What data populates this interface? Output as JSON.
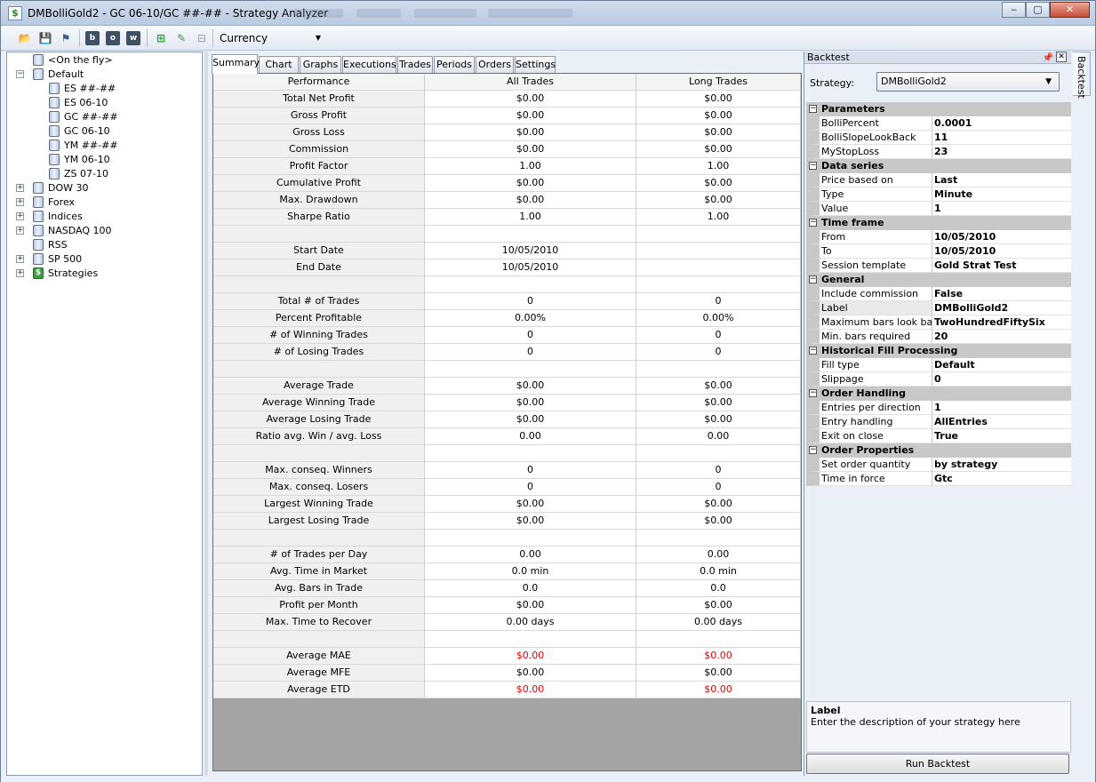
{
  "window": {
    "title": "DMBolliGold2 - GC 06-10/GC ##-## - Strategy Analyzer",
    "buttons": {
      "minimize": "‒",
      "maximize": "▢",
      "close": "✕"
    }
  },
  "toolbar": {
    "currency": "Currency"
  },
  "tree": [
    {
      "label": "<On the fly>",
      "indent": 1,
      "expander": "",
      "icon": "database-icon"
    },
    {
      "label": "Default",
      "indent": 0,
      "expander": "−",
      "icon": "database-icon"
    },
    {
      "label": "ES ##-##",
      "indent": 2,
      "expander": "",
      "icon": "database-icon"
    },
    {
      "label": "ES 06-10",
      "indent": 2,
      "expander": "",
      "icon": "database-icon"
    },
    {
      "label": "GC ##-##",
      "indent": 2,
      "expander": "",
      "icon": "database-icon"
    },
    {
      "label": "GC 06-10",
      "indent": 2,
      "expander": "",
      "icon": "database-icon"
    },
    {
      "label": "YM ##-##",
      "indent": 2,
      "expander": "",
      "icon": "database-icon"
    },
    {
      "label": "YM 06-10",
      "indent": 2,
      "expander": "",
      "icon": "database-icon"
    },
    {
      "label": "ZS 07-10",
      "indent": 2,
      "expander": "",
      "icon": "database-icon"
    },
    {
      "label": "DOW 30",
      "indent": 0,
      "expander": "+",
      "icon": "database-icon"
    },
    {
      "label": "Forex",
      "indent": 0,
      "expander": "+",
      "icon": "database-icon"
    },
    {
      "label": "Indices",
      "indent": 0,
      "expander": "+",
      "icon": "database-icon"
    },
    {
      "label": "NASDAQ 100",
      "indent": 0,
      "expander": "+",
      "icon": "database-icon"
    },
    {
      "label": "RSS",
      "indent": 1,
      "expander": "",
      "icon": "database-icon"
    },
    {
      "label": "SP 500",
      "indent": 0,
      "expander": "+",
      "icon": "database-icon"
    },
    {
      "label": "Strategies",
      "indent": 0,
      "expander": "+",
      "icon": "strategy-icon"
    }
  ],
  "tabs": [
    "Summary",
    "Chart",
    "Graphs",
    "Executions",
    "Trades",
    "Periods",
    "Orders",
    "Settings"
  ],
  "grid": {
    "headers": [
      "Performance",
      "All Trades",
      "Long Trades"
    ],
    "rows": [
      [
        "Total Net Profit",
        "$0.00",
        "$0.00"
      ],
      [
        "Gross Profit",
        "$0.00",
        "$0.00"
      ],
      [
        "Gross Loss",
        "$0.00",
        "$0.00"
      ],
      [
        "Commission",
        "$0.00",
        "$0.00"
      ],
      [
        "Profit Factor",
        "1.00",
        "1.00"
      ],
      [
        "Cumulative Profit",
        "$0.00",
        "$0.00"
      ],
      [
        "Max. Drawdown",
        "$0.00",
        "$0.00"
      ],
      [
        "Sharpe Ratio",
        "1.00",
        "1.00"
      ],
      [
        "",
        "",
        ""
      ],
      [
        "Start Date",
        "10/05/2010",
        ""
      ],
      [
        "End Date",
        "10/05/2010",
        ""
      ],
      [
        "",
        "",
        ""
      ],
      [
        "Total # of Trades",
        "0",
        "0"
      ],
      [
        "Percent Profitable",
        "0.00%",
        "0.00%"
      ],
      [
        "# of Winning Trades",
        "0",
        "0"
      ],
      [
        "# of Losing Trades",
        "0",
        "0"
      ],
      [
        "",
        "",
        ""
      ],
      [
        "Average Trade",
        "$0.00",
        "$0.00"
      ],
      [
        "Average Winning Trade",
        "$0.00",
        "$0.00"
      ],
      [
        "Average Losing Trade",
        "$0.00",
        "$0.00"
      ],
      [
        "Ratio avg. Win / avg. Loss",
        "0.00",
        "0.00"
      ],
      [
        "",
        "",
        ""
      ],
      [
        "Max. conseq. Winners",
        "0",
        "0"
      ],
      [
        "Max. conseq. Losers",
        "0",
        "0"
      ],
      [
        "Largest Winning Trade",
        "$0.00",
        "$0.00"
      ],
      [
        "Largest Losing Trade",
        "$0.00",
        "$0.00"
      ],
      [
        "",
        "",
        ""
      ],
      [
        "# of Trades per Day",
        "0.00",
        "0.00"
      ],
      [
        "Avg. Time in Market",
        "0.0 min",
        "0.0 min"
      ],
      [
        "Avg. Bars in Trade",
        "0.0",
        "0.0"
      ],
      [
        "Profit per Month",
        "$0.00",
        "$0.00"
      ],
      [
        "Max. Time to Recover",
        "0.00 days",
        "0.00 days"
      ],
      [
        "",
        "",
        ""
      ],
      [
        "Average MAE",
        "$0.00",
        "$0.00"
      ],
      [
        "Average MFE",
        "$0.00",
        "$0.00"
      ],
      [
        "Average ETD",
        "$0.00",
        "$0.00"
      ]
    ],
    "red_rows": [
      "Average MAE",
      "Average ETD"
    ],
    "red_color": "#e00000"
  },
  "backtest": {
    "title": "Backtest",
    "side_tab": "Backtest",
    "strategy_label": "Strategy:",
    "strategy_value": "DMBolliGold2",
    "categories": [
      {
        "name": "Parameters",
        "rows": [
          [
            "BolliPercent",
            "0.0001"
          ],
          [
            "BolliSlopeLookBack",
            "11"
          ],
          [
            "MyStopLoss",
            "23"
          ]
        ]
      },
      {
        "name": "Data series",
        "rows": [
          [
            "Price based on",
            "Last"
          ],
          [
            "Type",
            "Minute"
          ],
          [
            "Value",
            "1"
          ]
        ]
      },
      {
        "name": "Time frame",
        "rows": [
          [
            "From",
            "10/05/2010"
          ],
          [
            "To",
            "10/05/2010"
          ],
          [
            "Session template",
            "Gold Strat Test"
          ]
        ]
      },
      {
        "name": "General",
        "rows": [
          [
            "Include commission",
            "False"
          ],
          [
            "Label",
            "DMBolliGold2"
          ],
          [
            "Maximum bars look back",
            "TwoHundredFiftySix"
          ],
          [
            "Min. bars required",
            "20"
          ]
        ]
      },
      {
        "name": "Historical Fill Processing",
        "rows": [
          [
            "Fill type",
            "Default"
          ],
          [
            "Slippage",
            "0"
          ]
        ]
      },
      {
        "name": "Order Handling",
        "rows": [
          [
            "Entries per direction",
            "1"
          ],
          [
            "Entry handling",
            "AllEntries"
          ],
          [
            "Exit on close",
            "True"
          ]
        ]
      },
      {
        "name": "Order Properties",
        "rows": [
          [
            "Set order quantity",
            "by strategy"
          ],
          [
            "Time in force",
            "Gtc"
          ]
        ]
      }
    ],
    "selected_property": "Label",
    "description_title": "Label",
    "description_text": "Enter the description of your strategy here",
    "run_button": "Run Backtest"
  }
}
